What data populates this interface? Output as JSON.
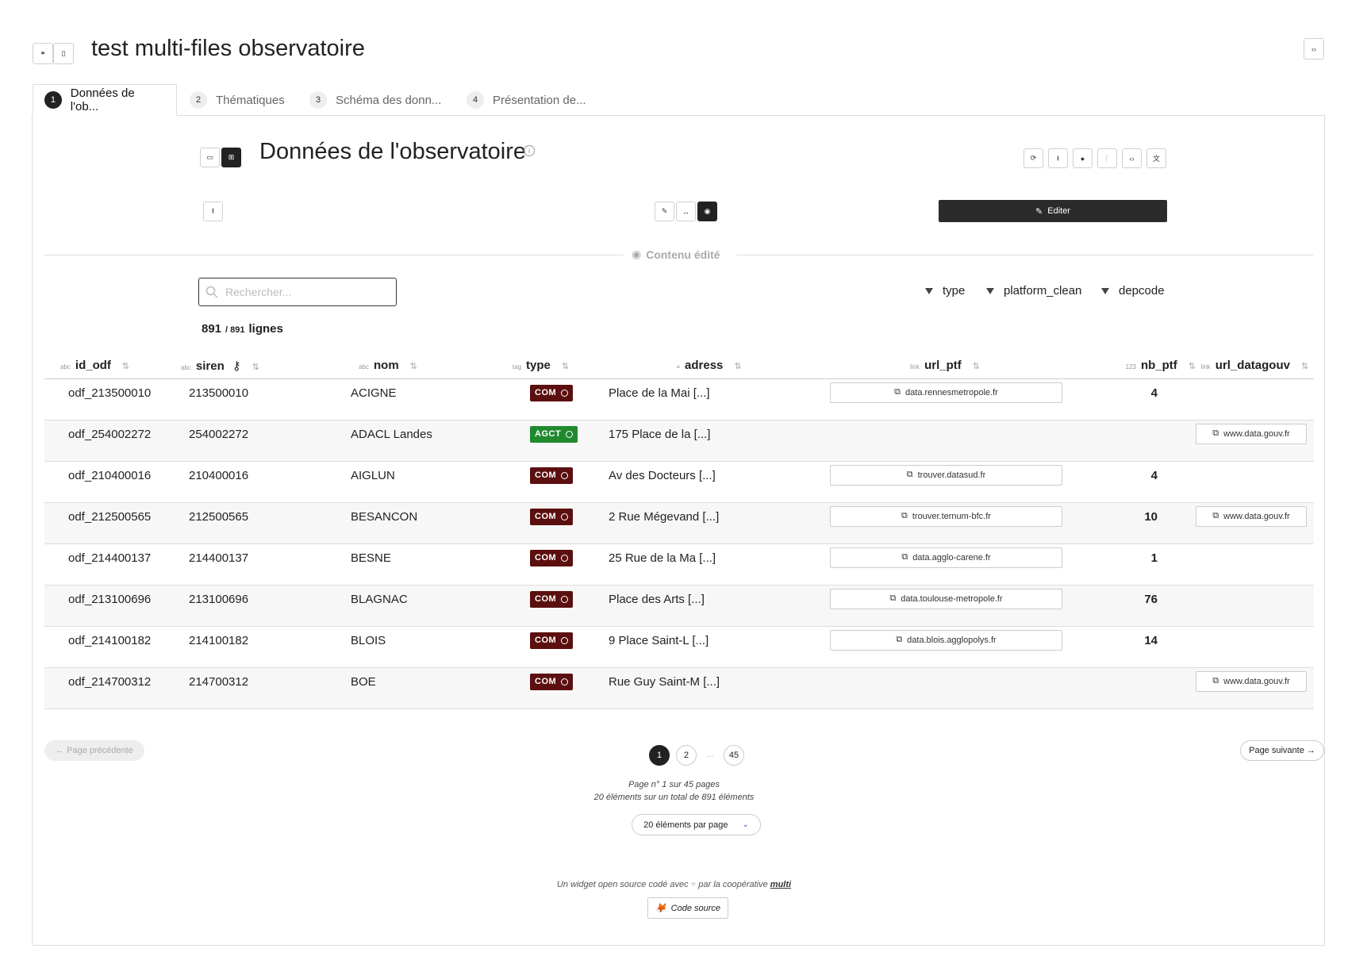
{
  "app": {
    "title": "test multi-files observatoire"
  },
  "tabs": [
    {
      "num": "1",
      "label": "Données de l'ob..."
    },
    {
      "num": "2",
      "label": "Thématiques"
    },
    {
      "num": "3",
      "label": "Schéma des donn..."
    },
    {
      "num": "4",
      "label": "Présentation de..."
    }
  ],
  "section": {
    "title": "Données de l'observatoire",
    "edit_label": "Editer",
    "content_label": "Contenu édité"
  },
  "search": {
    "placeholder": "Rechercher..."
  },
  "filters": [
    "type",
    "platform_clean",
    "depcode"
  ],
  "row_count": {
    "shown": "891",
    "total": "/ 891",
    "unit": "lignes"
  },
  "columns": [
    {
      "tic": "abc",
      "label": "id_odf",
      "key": false
    },
    {
      "tic": "abc",
      "label": "siren",
      "key": true
    },
    {
      "tic": "abc",
      "label": "nom",
      "key": false
    },
    {
      "tic": "tag",
      "label": "type",
      "key": false
    },
    {
      "tic": "≡",
      "label": "adress",
      "key": false
    },
    {
      "tic": "link",
      "label": "url_ptf",
      "key": false
    },
    {
      "tic": "123",
      "label": "nb_ptf",
      "key": false
    },
    {
      "tic": "link",
      "label": "url_datagouv",
      "key": false
    }
  ],
  "rows": [
    {
      "id_odf": "odf_213500010",
      "siren": "213500010",
      "nom": "ACIGNE",
      "type": "COM",
      "adress": "Place de la Mai [...]",
      "url_ptf": "data.rennesmetropole.fr",
      "nb_ptf": "4",
      "url_datagouv": ""
    },
    {
      "id_odf": "odf_254002272",
      "siren": "254002272",
      "nom": "ADACL Landes",
      "type": "AGCT",
      "adress": "175 Place de la [...]",
      "url_ptf": "",
      "nb_ptf": "",
      "url_datagouv": "www.data.gouv.fr"
    },
    {
      "id_odf": "odf_210400016",
      "siren": "210400016",
      "nom": "AIGLUN",
      "type": "COM",
      "adress": "Av des Docteurs [...]",
      "url_ptf": "trouver.datasud.fr",
      "nb_ptf": "4",
      "url_datagouv": ""
    },
    {
      "id_odf": "odf_212500565",
      "siren": "212500565",
      "nom": "BESANCON",
      "type": "COM",
      "adress": "2 Rue Mégevand [...]",
      "url_ptf": "trouver.ternum-bfc.fr",
      "nb_ptf": "10",
      "url_datagouv": "www.data.gouv.fr"
    },
    {
      "id_odf": "odf_214400137",
      "siren": "214400137",
      "nom": "BESNE",
      "type": "COM",
      "adress": "25 Rue de la Ma [...]",
      "url_ptf": "data.agglo-carene.fr",
      "nb_ptf": "1",
      "url_datagouv": ""
    },
    {
      "id_odf": "odf_213100696",
      "siren": "213100696",
      "nom": "BLAGNAC",
      "type": "COM",
      "adress": "Place des Arts [...]",
      "url_ptf": "data.toulouse-metropole.fr",
      "nb_ptf": "76",
      "url_datagouv": ""
    },
    {
      "id_odf": "odf_214100182",
      "siren": "214100182",
      "nom": "BLOIS",
      "type": "COM",
      "adress": "9 Place Saint-L [...]",
      "url_ptf": "data.blois.agglopolys.fr",
      "nb_ptf": "14",
      "url_datagouv": ""
    },
    {
      "id_odf": "odf_214700312",
      "siren": "214700312",
      "nom": "BOE",
      "type": "COM",
      "adress": "Rue Guy Saint-M [...]",
      "url_ptf": "",
      "nb_ptf": "",
      "url_datagouv": "www.data.gouv.fr"
    }
  ],
  "badge_colors": {
    "COM": "#5c0f0f",
    "AGCT": "#1f8a2e"
  },
  "pagination": {
    "prev": "← Page précédente",
    "next": "Page suivante →",
    "pages": [
      "1",
      "2",
      "45"
    ],
    "dots": "...",
    "page_info": "Page n° 1 sur 45 pages",
    "total_info": "20 éléments sur un total de 891 éléments",
    "per_page": "20 éléments par page"
  },
  "footer": {
    "text_before": "Un widget open source codé avec",
    "text_after": "par la coopérative",
    "brand": "multi",
    "source_btn": "Code source"
  }
}
